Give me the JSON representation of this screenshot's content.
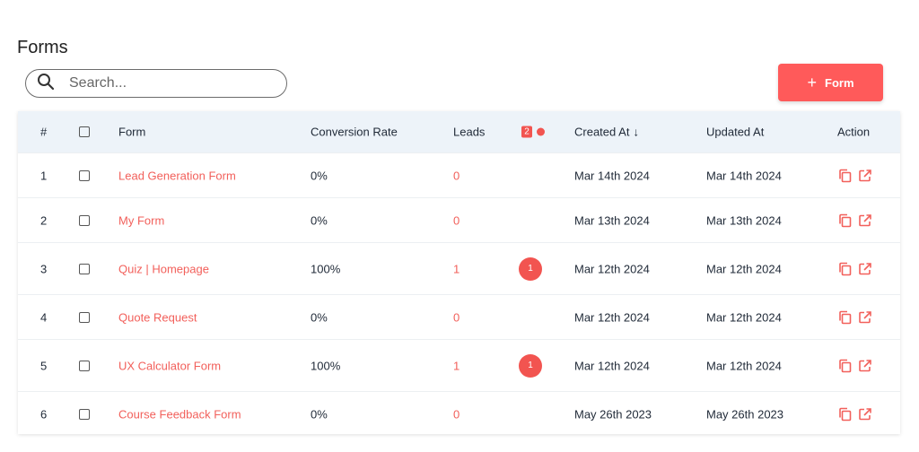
{
  "page": {
    "title": "Forms"
  },
  "search": {
    "placeholder": "Search..."
  },
  "add_button": {
    "icon": "+",
    "label": "Form"
  },
  "colors": {
    "accent": "#ff5a5a",
    "header_bg": "#edf3f9",
    "link": "#f2605b"
  },
  "table": {
    "headers": {
      "num": "#",
      "form": "Form",
      "conversion": "Conversion Rate",
      "leads": "Leads",
      "badge_count": "2",
      "created": "Created At",
      "created_sort": "↓",
      "updated": "Updated At",
      "action": "Action"
    },
    "rows": [
      {
        "num": "1",
        "form": "Lead Generation Form",
        "conversion": "0%",
        "leads": "0",
        "badge": "",
        "created": "Mar 14th 2024",
        "updated": "Mar 14th 2024"
      },
      {
        "num": "2",
        "form": "My Form",
        "conversion": "0%",
        "leads": "0",
        "badge": "",
        "created": "Mar 13th 2024",
        "updated": "Mar 13th 2024"
      },
      {
        "num": "3",
        "form": "Quiz | Homepage",
        "conversion": "100%",
        "leads": "1",
        "badge": "1",
        "created": "Mar 12th 2024",
        "updated": "Mar 12th 2024"
      },
      {
        "num": "4",
        "form": "Quote Request",
        "conversion": "0%",
        "leads": "0",
        "badge": "",
        "created": "Mar 12th 2024",
        "updated": "Mar 12th 2024"
      },
      {
        "num": "5",
        "form": "UX Calculator Form",
        "conversion": "100%",
        "leads": "1",
        "badge": "1",
        "created": "Mar 12th 2024",
        "updated": "Mar 12th 2024"
      },
      {
        "num": "6",
        "form": "Course Feedback Form",
        "conversion": "0%",
        "leads": "0",
        "badge": "",
        "created": "May 26th 2023",
        "updated": "May 26th 2023"
      }
    ],
    "action_icons": [
      "copy-icon",
      "external-link-icon"
    ]
  }
}
